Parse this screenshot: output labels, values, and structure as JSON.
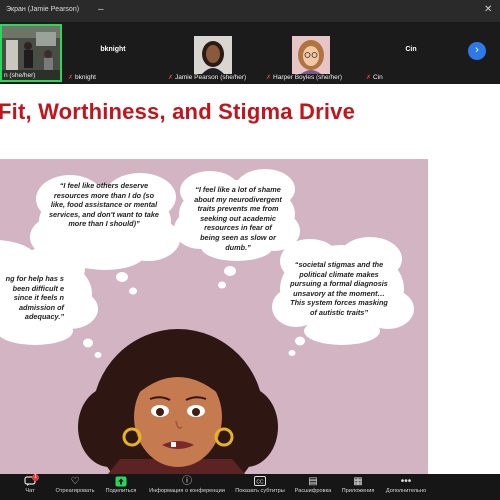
{
  "window": {
    "title": "Экран (Jamie Pearson)"
  },
  "participants": [
    {
      "display_name": "n (she/her)",
      "muted": true
    },
    {
      "display_name": "bknight",
      "video_label": "bknight",
      "muted": true
    },
    {
      "display_name": "Jamie Pearson (she/her)",
      "muted": true
    },
    {
      "display_name": "Harper Boyles (she/her)",
      "muted": true
    },
    {
      "display_name": "Cin",
      "video_label": "Cin",
      "muted": true
    }
  ],
  "slide": {
    "title": "Fit, Worthiness, and Stigma Drive",
    "quotes": [
      "“I feel like others deserve resources more than I do (so like, food assistance or mental services, and don't want to take more than I should)”",
      "“I feel like a lot of shame about my neurodivergent traits prevents me from seeking out academic resources in fear of being seen as slow or dumb.”",
      "“societal stigmas and the political climate makes pursuing a formal diagnosis unsavory at the moment…This system forces masking of autistic traits”",
      "ng for help has s been difficult e since it feels n admission of adequacy.”"
    ]
  },
  "toolbar": {
    "chat": {
      "label": "Чат",
      "badge": "1"
    },
    "items": [
      {
        "label": "Отреагировать",
        "icon": "heart-plus-icon"
      },
      {
        "label": "Поделиться",
        "icon": "share-arrow-icon"
      },
      {
        "label": "Информация о конференции",
        "icon": "info-icon"
      },
      {
        "label": "Показать субтитры",
        "icon": "cc-icon"
      },
      {
        "label": "Расшифровка",
        "icon": "transcript-icon"
      },
      {
        "label": "Приложения",
        "icon": "apps-icon"
      },
      {
        "label": "Дополнительно",
        "icon": "more-icon"
      }
    ]
  },
  "colors": {
    "accent_green": "#2bd65f",
    "title_red": "#c4141b",
    "slide_art_bg": "#d2b4c2",
    "next_button_blue": "#2f78e8"
  }
}
